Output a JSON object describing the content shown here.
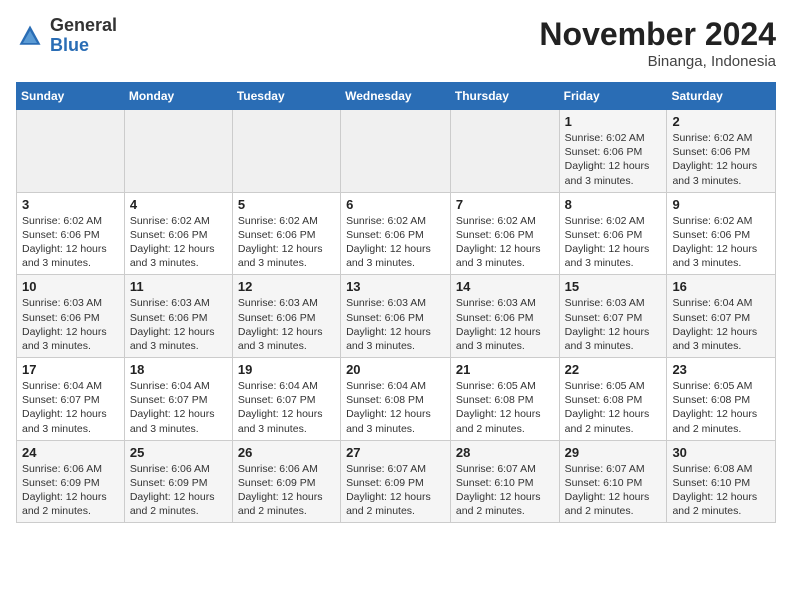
{
  "header": {
    "logo_general": "General",
    "logo_blue": "Blue",
    "month": "November 2024",
    "location": "Binanga, Indonesia"
  },
  "weekdays": [
    "Sunday",
    "Monday",
    "Tuesday",
    "Wednesday",
    "Thursday",
    "Friday",
    "Saturday"
  ],
  "weeks": [
    [
      {
        "day": "",
        "info": ""
      },
      {
        "day": "",
        "info": ""
      },
      {
        "day": "",
        "info": ""
      },
      {
        "day": "",
        "info": ""
      },
      {
        "day": "",
        "info": ""
      },
      {
        "day": "1",
        "info": "Sunrise: 6:02 AM\nSunset: 6:06 PM\nDaylight: 12 hours and 3 minutes."
      },
      {
        "day": "2",
        "info": "Sunrise: 6:02 AM\nSunset: 6:06 PM\nDaylight: 12 hours and 3 minutes."
      }
    ],
    [
      {
        "day": "3",
        "info": "Sunrise: 6:02 AM\nSunset: 6:06 PM\nDaylight: 12 hours and 3 minutes."
      },
      {
        "day": "4",
        "info": "Sunrise: 6:02 AM\nSunset: 6:06 PM\nDaylight: 12 hours and 3 minutes."
      },
      {
        "day": "5",
        "info": "Sunrise: 6:02 AM\nSunset: 6:06 PM\nDaylight: 12 hours and 3 minutes."
      },
      {
        "day": "6",
        "info": "Sunrise: 6:02 AM\nSunset: 6:06 PM\nDaylight: 12 hours and 3 minutes."
      },
      {
        "day": "7",
        "info": "Sunrise: 6:02 AM\nSunset: 6:06 PM\nDaylight: 12 hours and 3 minutes."
      },
      {
        "day": "8",
        "info": "Sunrise: 6:02 AM\nSunset: 6:06 PM\nDaylight: 12 hours and 3 minutes."
      },
      {
        "day": "9",
        "info": "Sunrise: 6:02 AM\nSunset: 6:06 PM\nDaylight: 12 hours and 3 minutes."
      }
    ],
    [
      {
        "day": "10",
        "info": "Sunrise: 6:03 AM\nSunset: 6:06 PM\nDaylight: 12 hours and 3 minutes."
      },
      {
        "day": "11",
        "info": "Sunrise: 6:03 AM\nSunset: 6:06 PM\nDaylight: 12 hours and 3 minutes."
      },
      {
        "day": "12",
        "info": "Sunrise: 6:03 AM\nSunset: 6:06 PM\nDaylight: 12 hours and 3 minutes."
      },
      {
        "day": "13",
        "info": "Sunrise: 6:03 AM\nSunset: 6:06 PM\nDaylight: 12 hours and 3 minutes."
      },
      {
        "day": "14",
        "info": "Sunrise: 6:03 AM\nSunset: 6:06 PM\nDaylight: 12 hours and 3 minutes."
      },
      {
        "day": "15",
        "info": "Sunrise: 6:03 AM\nSunset: 6:07 PM\nDaylight: 12 hours and 3 minutes."
      },
      {
        "day": "16",
        "info": "Sunrise: 6:04 AM\nSunset: 6:07 PM\nDaylight: 12 hours and 3 minutes."
      }
    ],
    [
      {
        "day": "17",
        "info": "Sunrise: 6:04 AM\nSunset: 6:07 PM\nDaylight: 12 hours and 3 minutes."
      },
      {
        "day": "18",
        "info": "Sunrise: 6:04 AM\nSunset: 6:07 PM\nDaylight: 12 hours and 3 minutes."
      },
      {
        "day": "19",
        "info": "Sunrise: 6:04 AM\nSunset: 6:07 PM\nDaylight: 12 hours and 3 minutes."
      },
      {
        "day": "20",
        "info": "Sunrise: 6:04 AM\nSunset: 6:08 PM\nDaylight: 12 hours and 3 minutes."
      },
      {
        "day": "21",
        "info": "Sunrise: 6:05 AM\nSunset: 6:08 PM\nDaylight: 12 hours and 2 minutes."
      },
      {
        "day": "22",
        "info": "Sunrise: 6:05 AM\nSunset: 6:08 PM\nDaylight: 12 hours and 2 minutes."
      },
      {
        "day": "23",
        "info": "Sunrise: 6:05 AM\nSunset: 6:08 PM\nDaylight: 12 hours and 2 minutes."
      }
    ],
    [
      {
        "day": "24",
        "info": "Sunrise: 6:06 AM\nSunset: 6:09 PM\nDaylight: 12 hours and 2 minutes."
      },
      {
        "day": "25",
        "info": "Sunrise: 6:06 AM\nSunset: 6:09 PM\nDaylight: 12 hours and 2 minutes."
      },
      {
        "day": "26",
        "info": "Sunrise: 6:06 AM\nSunset: 6:09 PM\nDaylight: 12 hours and 2 minutes."
      },
      {
        "day": "27",
        "info": "Sunrise: 6:07 AM\nSunset: 6:09 PM\nDaylight: 12 hours and 2 minutes."
      },
      {
        "day": "28",
        "info": "Sunrise: 6:07 AM\nSunset: 6:10 PM\nDaylight: 12 hours and 2 minutes."
      },
      {
        "day": "29",
        "info": "Sunrise: 6:07 AM\nSunset: 6:10 PM\nDaylight: 12 hours and 2 minutes."
      },
      {
        "day": "30",
        "info": "Sunrise: 6:08 AM\nSunset: 6:10 PM\nDaylight: 12 hours and 2 minutes."
      }
    ]
  ]
}
